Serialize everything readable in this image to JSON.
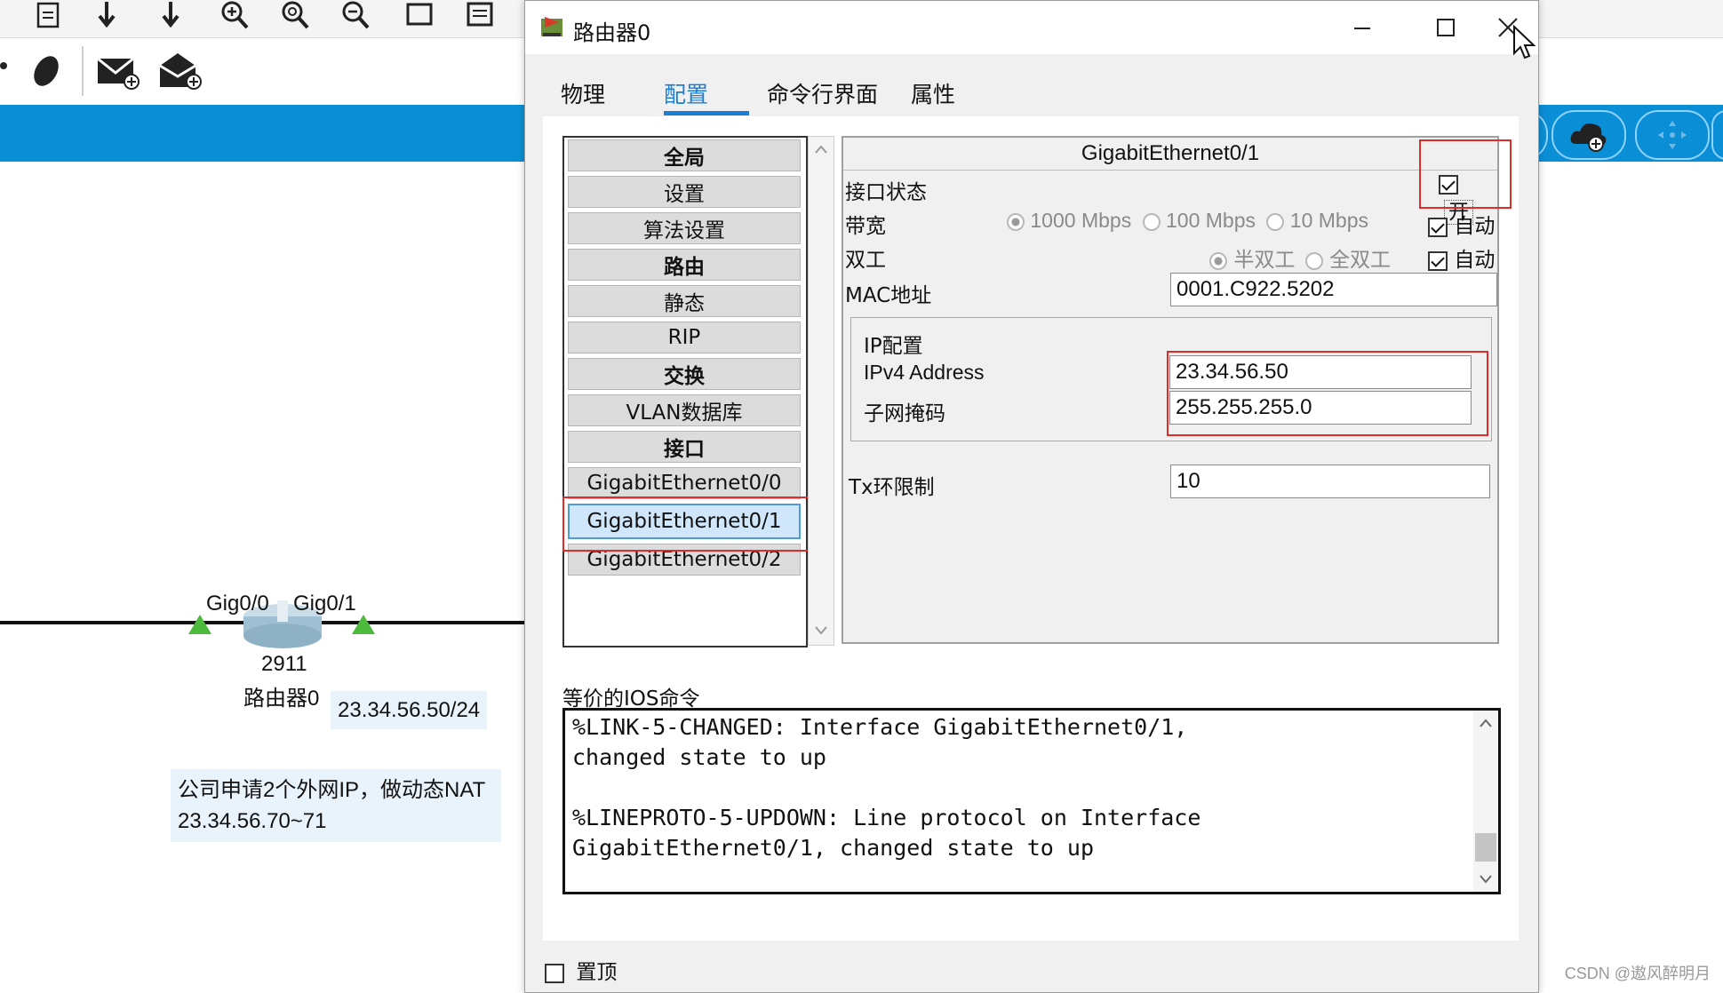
{
  "workspace": {
    "ports": {
      "left": "Gig0/0",
      "right": "Gig0/1"
    },
    "router_model": "2911",
    "router_name": "路由器0",
    "ip_label": "23.34.56.50/24",
    "note_line1": "公司申请2个外网IP，做动态NAT",
    "note_line2": "23.34.56.70~71",
    "watermark": "CSDN @遨风醉明月"
  },
  "dialog": {
    "title": "路由器0",
    "tabs": [
      "物理",
      "配置",
      "命令行界面",
      "属性"
    ],
    "active_tab": "配置",
    "nav": [
      {
        "label": "全局",
        "header": true
      },
      {
        "label": "设置",
        "header": false
      },
      {
        "label": "算法设置",
        "header": false
      },
      {
        "label": "路由",
        "header": true
      },
      {
        "label": "静态",
        "header": false
      },
      {
        "label": "RIP",
        "header": false
      },
      {
        "label": "交换",
        "header": true
      },
      {
        "label": "VLAN数据库",
        "header": false
      },
      {
        "label": "接口",
        "header": true
      },
      {
        "label": "GigabitEthernet0/0",
        "header": false
      },
      {
        "label": "GigabitEthernet0/1",
        "header": false,
        "selected": true
      },
      {
        "label": "GigabitEthernet0/2",
        "header": false
      }
    ],
    "interface": {
      "title": "GigabitEthernet0/1",
      "status_label": "接口状态",
      "status_on_label": "开",
      "status_on": true,
      "bandwidth_label": "带宽",
      "bandwidth_options": [
        "1000 Mbps",
        "100 Mbps",
        "10 Mbps"
      ],
      "bandwidth_auto_label": "自动",
      "duplex_label": "双工",
      "duplex_options": [
        "半双工",
        "全双工"
      ],
      "duplex_auto_label": "自动",
      "mac_label": "MAC地址",
      "mac_value": "0001.C922.5202",
      "ip_group_label": "IP配置",
      "ipv4_label": "IPv4 Address",
      "ipv4_value": "23.34.56.50",
      "mask_label": "子网掩码",
      "mask_value": "255.255.255.0",
      "tx_label": "Tx环限制",
      "tx_value": "10"
    },
    "ios_label": "等价的IOS命令",
    "console_lines": [
      "%LINK-5-CHANGED: Interface GigabitEthernet0/1,",
      "changed state to up",
      "",
      "%LINEPROTO-5-UPDOWN: Line protocol on Interface",
      "GigabitEthernet0/1, changed state to up"
    ],
    "pin_label": "置顶",
    "pin_checked": false
  }
}
